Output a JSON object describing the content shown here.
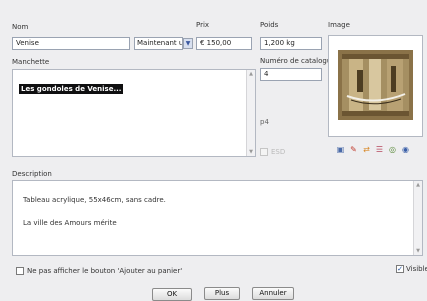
{
  "form": {
    "nom": {
      "label": "Nom",
      "value": "Venise"
    },
    "prix": {
      "label": "Prix",
      "availability": "Maintenant un",
      "value": "€ 150,00"
    },
    "poids": {
      "label": "Poids",
      "value": "1,200 kg"
    },
    "catalogue": {
      "label": "Numéro de catalogue",
      "value": "4"
    },
    "image": {
      "label": "Image"
    },
    "manchette": {
      "label": "Manchette",
      "text": "Les gondoles de Venise..."
    },
    "page_ref": "p4",
    "esd": {
      "label": "ESD",
      "checked": false
    },
    "description": {
      "label": "Description",
      "line1": "Tableau acrylique, 55x46cm, sans cadre.",
      "line2": "La ville des Amours mérite"
    },
    "hide_cart": {
      "label": "Ne pas afficher le bouton 'Ajouter au panier'",
      "checked": false
    },
    "visible": {
      "label": "Visible",
      "checked": true
    }
  },
  "image_tools": [
    "image-edit-icon",
    "pencil-icon",
    "swap-icon",
    "stack-icon",
    "target-icon",
    "globe-icon"
  ],
  "buttons": {
    "ok": "OK",
    "plus": "Plus",
    "annuler": "Annuler"
  },
  "colors": {
    "accent": "#3a58a0",
    "selection_bg": "#0f0f10",
    "selection_fg": "#ffffff"
  }
}
